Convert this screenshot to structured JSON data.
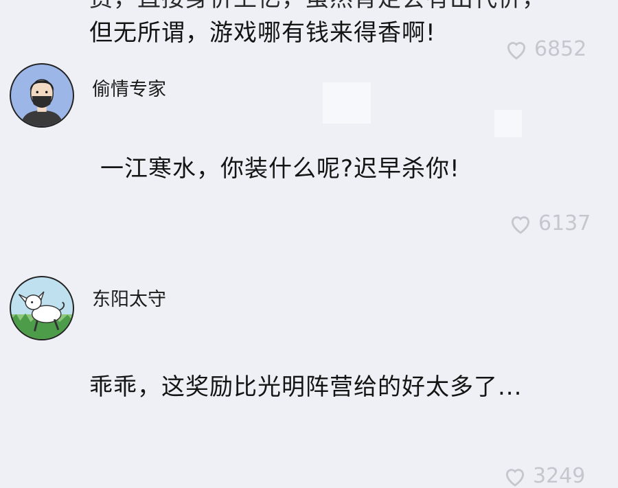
{
  "comments": [
    {
      "text_lines": [
        "费，直接身价上亿，虽然肯定会有出代价，",
        "但无所谓，游戏哪有钱来得香啊!"
      ],
      "likes": "6852"
    },
    {
      "username": "偷情专家",
      "avatar": "man-with-mask-avatar",
      "text": "一江寒水，你装什么呢?迟早杀你!",
      "likes": "6137"
    },
    {
      "username": "东阳太守",
      "avatar": "white-goat-avatar",
      "text": "乖乖，这奖励比光明阵营给的好太多了...",
      "likes": "3249"
    }
  ],
  "colors": {
    "background": "#eef0f6",
    "like_gray": "#c4c7ce"
  }
}
